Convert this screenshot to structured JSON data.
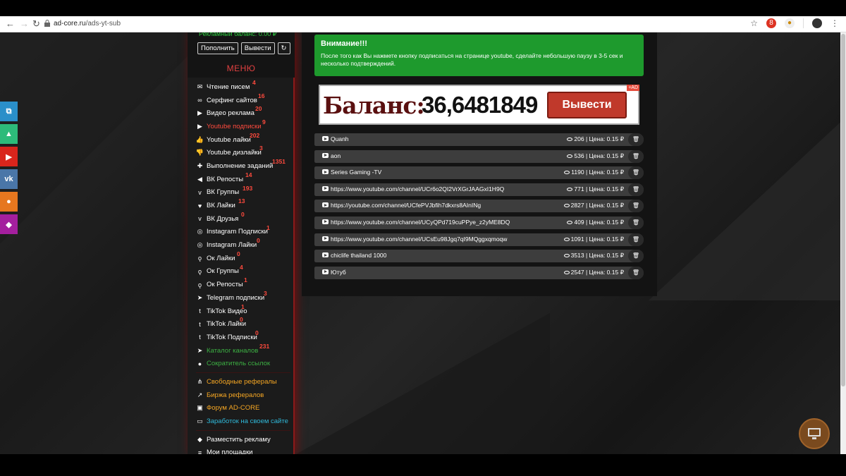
{
  "browser": {
    "url_host": "ad-core.ru",
    "url_path": "/ads-yt-sub"
  },
  "sidebar_social": [
    "windows-icon",
    "android-icon",
    "youtube-icon",
    "vk-icon",
    "gamepad-icon",
    "diamond-icon"
  ],
  "account": {
    "ad_balance": "Рекламный баланс: 0.00 ₽",
    "topup": "Пополнить",
    "withdraw": "Вывести",
    "refresh_icon": "refresh-icon"
  },
  "menu": {
    "title": "МЕНЮ",
    "items": [
      {
        "label": "Чтение писем",
        "count": "4",
        "icon": "envelope-icon",
        "style": "normal"
      },
      {
        "label": "Серфинг сайтов",
        "count": "16",
        "icon": "link-icon",
        "style": "normal"
      },
      {
        "label": "Видео реклама",
        "count": "20",
        "icon": "video-icon",
        "style": "normal"
      },
      {
        "label": "Youtube подписки",
        "count": "9",
        "icon": "youtube-icon",
        "style": "red"
      },
      {
        "label": "Youtube лайки",
        "count": "202",
        "icon": "thumbs-up-icon",
        "style": "normal"
      },
      {
        "label": "Youtube дизлайки",
        "count": "3",
        "icon": "thumbs-down-icon",
        "style": "normal"
      },
      {
        "label": "Выполнение заданий",
        "count": "1351",
        "icon": "puzzle-icon",
        "style": "normal"
      },
      {
        "label": "ВК Репосты",
        "count": "14",
        "icon": "megaphone-icon",
        "style": "normal"
      },
      {
        "label": "ВК Группы",
        "count": "193",
        "icon": "vk-icon",
        "style": "normal"
      },
      {
        "label": "ВК Лайки",
        "count": "13",
        "icon": "heart-icon",
        "style": "normal"
      },
      {
        "label": "ВК Друзья",
        "count": "0",
        "icon": "vk-icon",
        "style": "normal"
      },
      {
        "label": "Instagram Подписки",
        "count": "1",
        "icon": "instagram-icon",
        "style": "normal"
      },
      {
        "label": "Instagram Лайки",
        "count": "0",
        "icon": "instagram-icon",
        "style": "normal"
      },
      {
        "label": "Ок Лайки",
        "count": "0",
        "icon": "odnoklassniki-icon",
        "style": "normal"
      },
      {
        "label": "Ок Группы",
        "count": "4",
        "icon": "odnoklassniki-icon",
        "style": "normal"
      },
      {
        "label": "Ок Репосты",
        "count": "1",
        "icon": "odnoklassniki-icon",
        "style": "normal"
      },
      {
        "label": "Telegram подписки",
        "count": "3",
        "icon": "telegram-icon",
        "style": "normal"
      },
      {
        "label": "TikTok Видео",
        "count": "1",
        "icon": "tiktok-icon",
        "style": "normal"
      },
      {
        "label": "TikTok Лайки",
        "count": "0",
        "icon": "tiktok-icon",
        "style": "normal"
      },
      {
        "label": "TikTok Подписки",
        "count": "0",
        "icon": "tiktok-icon",
        "style": "normal"
      },
      {
        "label": "Каталог каналов",
        "count": "231",
        "icon": "paper-plane-icon",
        "style": "green"
      },
      {
        "label": "Сократитель ссылок",
        "count": "",
        "icon": "globe-icon",
        "style": "green"
      }
    ],
    "extra": [
      {
        "label": "Свободные рефералы",
        "icon": "sitemap-icon",
        "style": "orange"
      },
      {
        "label": "Биржа рефералов",
        "icon": "chart-line-icon",
        "style": "orange"
      },
      {
        "label": "Форум AD-CORE",
        "icon": "comments-icon",
        "style": "orange"
      },
      {
        "label": "Заработок на своем сайте",
        "icon": "monitor-icon",
        "style": "cyan"
      }
    ],
    "bottom": [
      {
        "label": "Разместить рекламу",
        "icon": "ad-icon",
        "style": "normal"
      },
      {
        "label": "Мои площадки",
        "icon": "list-icon",
        "style": "normal"
      }
    ]
  },
  "alert": {
    "heading": "Внимание!!!",
    "text": "После того как Вы нажмете кнопку подписаться на странице youtube, сделайте небольшую паузу в 3-5 сек и несколько подтверждений."
  },
  "banner": {
    "label": "Баланс:",
    "value": "36,6481849",
    "button": "Вывести",
    "ad_tag": "+AD"
  },
  "channels": [
    {
      "name": "Quanh",
      "views": "206",
      "price": "Цена: 0.15 ₽"
    },
    {
      "name": "aon",
      "views": "536",
      "price": "Цена: 0.15 ₽"
    },
    {
      "name": "Series Gaming -TV",
      "views": "1190",
      "price": "Цена: 0.15 ₽"
    },
    {
      "name": "https://www.youtube.com/channel/UCr6o2QI2VrXGrJAAGxI1H9Q",
      "views": "771",
      "price": "Цена: 0.15 ₽"
    },
    {
      "name": "https://youtube.com/channel/UCfePVJbfih7dkxrs8AInINg",
      "views": "2827",
      "price": "Цена: 0.15 ₽"
    },
    {
      "name": "https://www.youtube.com/channel/UCyQPd719cuPPye_z2yME8DQ",
      "views": "409",
      "price": "Цена: 0.15 ₽"
    },
    {
      "name": "https://www.youtube.com/channel/UCsEu98Jgq7qI9MQggxqmoqw",
      "views": "1091",
      "price": "Цена: 0.15 ₽"
    },
    {
      "name": "chiclife thailand 1000",
      "views": "3513",
      "price": "Цена: 0.15 ₽"
    },
    {
      "name": "Ютуб",
      "views": "2547",
      "price": "Цена: 0.15 ₽"
    }
  ],
  "colors": {
    "accent_red": "#ff4a3d",
    "alert_green": "#1e9a2d",
    "menu_bg": "#1b1b1b"
  }
}
